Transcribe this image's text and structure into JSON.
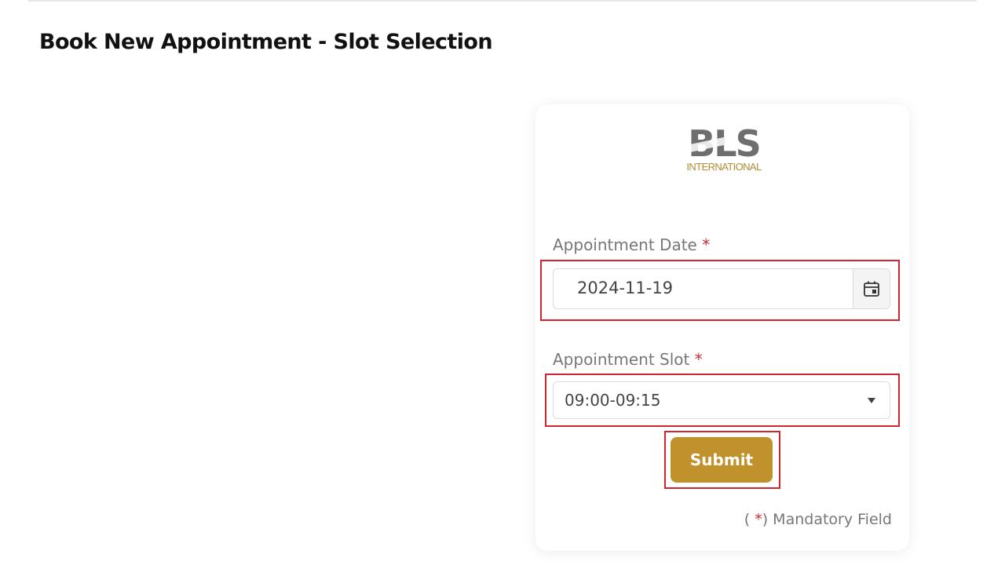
{
  "page": {
    "title": "Book New Appointment - Slot Selection"
  },
  "logo": {
    "main": "BLS",
    "sub": "INTERNATIONAL"
  },
  "form": {
    "date_label": "Appointment Date",
    "date_value": "2024-11-19",
    "slot_label": "Appointment Slot",
    "slot_value": "09:00-09:15",
    "required_marker": "*",
    "submit_label": "Submit",
    "mandatory_note_open": "( ",
    "mandatory_note_close": ") Mandatory Field"
  },
  "icons": {
    "date_picker": "calendar-icon",
    "slot_dropdown": "chevron-down-icon"
  },
  "colors": {
    "accent": "#bf922c",
    "highlight": "#d2232f",
    "required": "#cc2b36",
    "label": "#777777"
  }
}
